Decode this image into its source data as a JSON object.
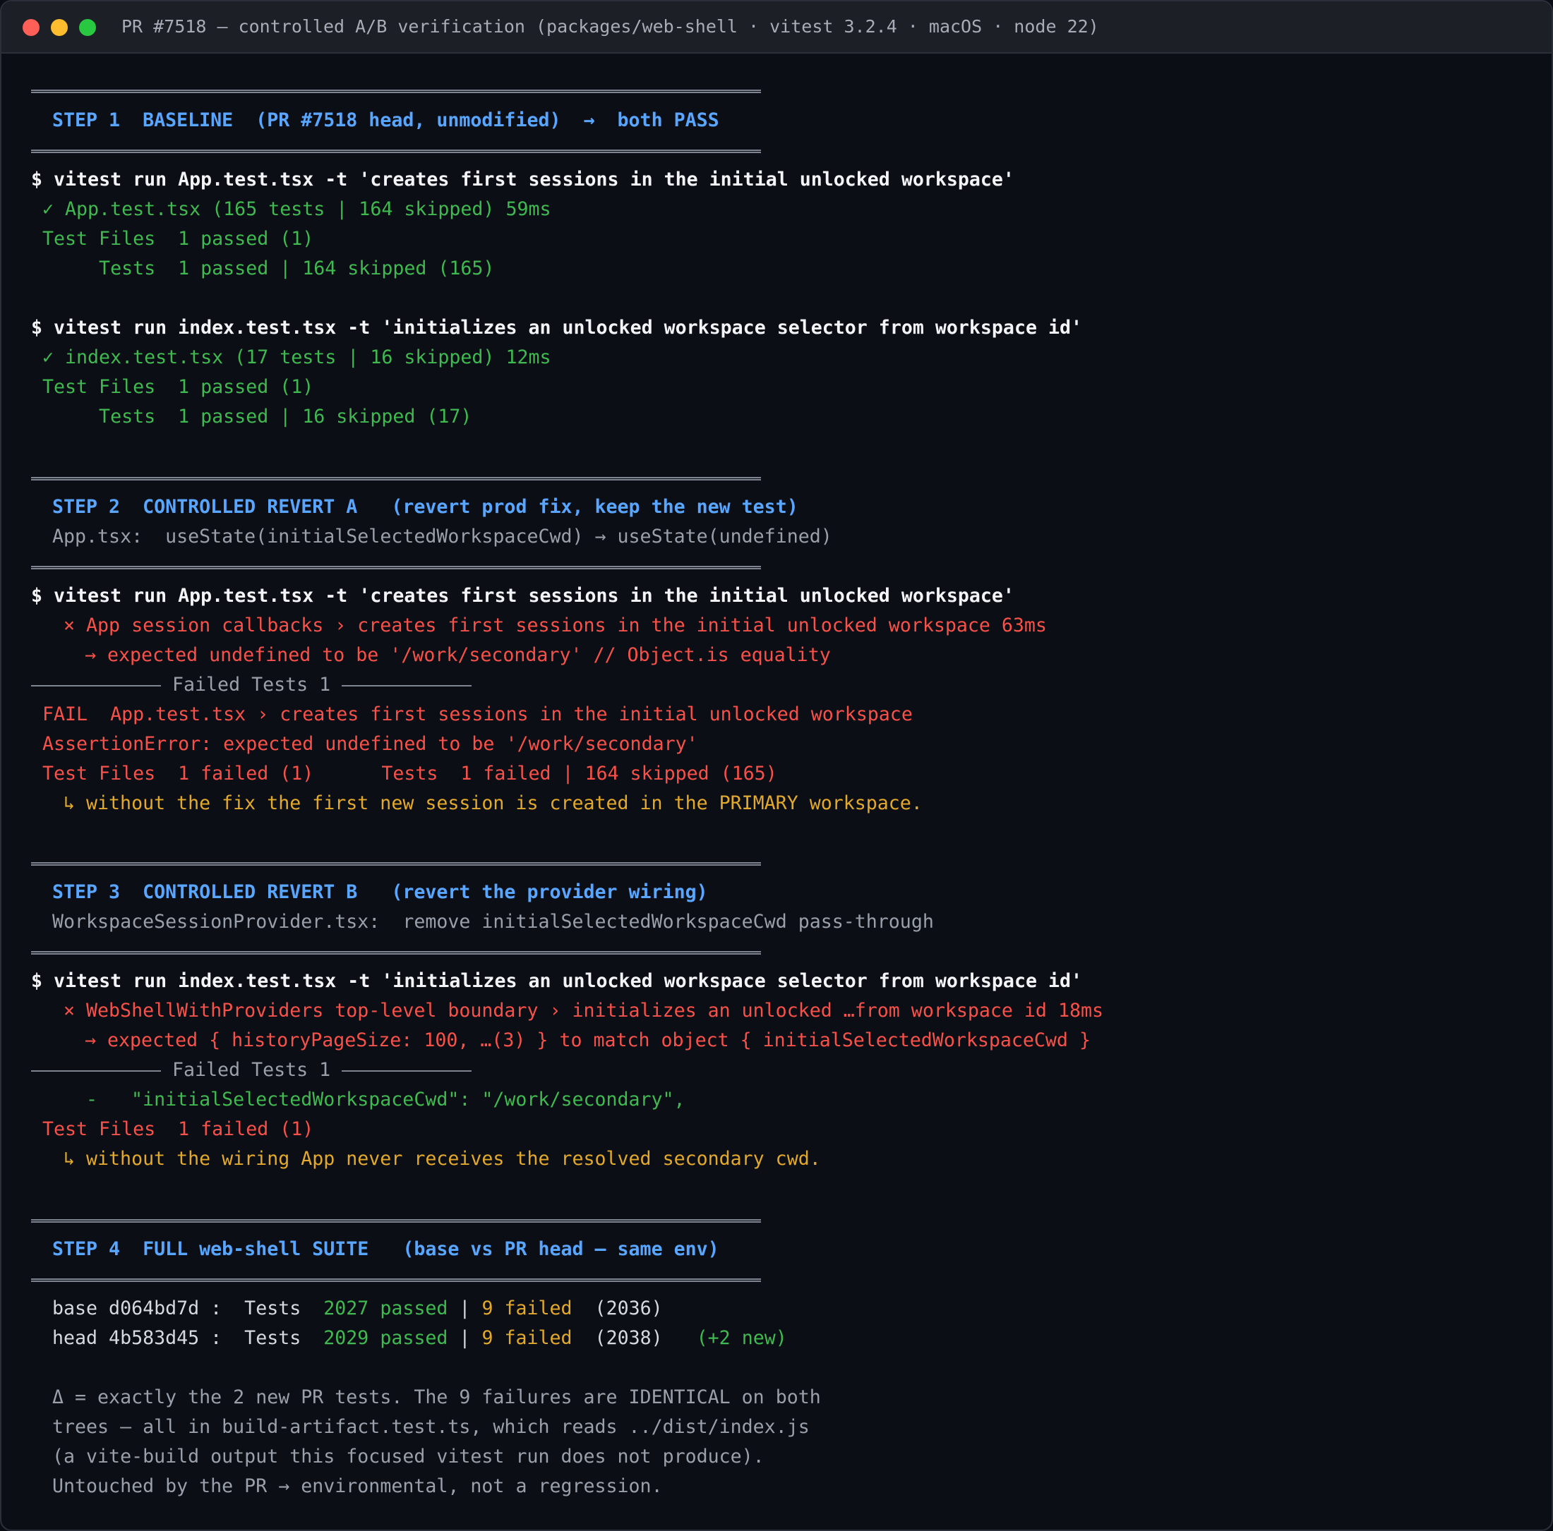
{
  "window": {
    "title": "PR #7518 — controlled A/B verification (packages/web-shell · vitest 3.2.4 · macOS · node 22)"
  },
  "step1": {
    "header": "STEP 1  BASELINE  (PR #7518 head, unmodified)  →  both PASS",
    "cmd1": "$ vitest run App.test.tsx -t 'creates first sessions in the initial unlocked workspace'",
    "res1": "✓ App.test.tsx (165 tests | 164 skipped) 59ms",
    "files1": "Test Files  1 passed (1)",
    "tests1": "     Tests  1 passed | 164 skipped (165)",
    "cmd2": "$ vitest run index.test.tsx -t 'initializes an unlocked workspace selector from workspace id'",
    "res2": "✓ index.test.tsx (17 tests | 16 skipped) 12ms",
    "files2": "Test Files  1 passed (1)",
    "tests2": "     Tests  1 passed | 16 skipped (17)"
  },
  "step2": {
    "header": "STEP 2  CONTROLLED REVERT A   (revert prod fix, keep the new test)",
    "sub": "App.tsx:  useState(initialSelectedWorkspaceCwd) → useState(undefined)",
    "cmd": "$ vitest run App.test.tsx -t 'creates first sessions in the initial unlocked workspace'",
    "fail_line": "× App session callbacks › creates first sessions in the initial unlocked workspace 63ms",
    "expect_line": "→ expected undefined to be '/work/secondary' // Object.is equality",
    "failed_tests": "Failed Tests 1",
    "fail_detail": "FAIL  App.test.tsx › creates first sessions in the initial unlocked workspace",
    "assertion": "AssertionError: expected undefined to be '/work/secondary'",
    "summary": "Test Files  1 failed (1)      Tests  1 failed | 164 skipped (165)",
    "note": "↳ without the fix the first new session is created in the PRIMARY workspace."
  },
  "step3": {
    "header": "STEP 3  CONTROLLED REVERT B   (revert the provider wiring)",
    "sub": "WorkspaceSessionProvider.tsx:  remove initialSelectedWorkspaceCwd pass-through",
    "cmd": "$ vitest run index.test.tsx -t 'initializes an unlocked workspace selector from workspace id'",
    "fail_line": "× WebShellWithProviders top-level boundary › initializes an unlocked …from workspace id 18ms",
    "expect_line": "→ expected { historyPageSize: 100, …(3) } to match object { initialSelectedWorkspaceCwd }",
    "failed_tests": "Failed Tests 1",
    "diff_line": "-   \"initialSelectedWorkspaceCwd\": \"/work/secondary\",",
    "summary": "Test Files  1 failed (1)",
    "note": "↳ without the wiring App never receives the resolved secondary cwd."
  },
  "step4": {
    "header": "STEP 4  FULL web-shell SUITE   (base vs PR head — same env)",
    "base": {
      "label": "base d064bd7d :  Tests  ",
      "passed": "2027 passed",
      "pipe": " | ",
      "failed": "9 failed",
      "total": "  (2036)"
    },
    "head": {
      "label": "head 4b583d45 :  Tests  ",
      "passed": "2029 passed",
      "pipe": " | ",
      "failed": "9 failed",
      "total": "  (2038)",
      "new": "   (+2 new)"
    },
    "notes": [
      "Δ = exactly the 2 new PR tests. The 9 failures are IDENTICAL on both",
      "trees — all in build-artifact.test.ts, which reads ../dist/index.js",
      "(a vite-build output this focused vitest run does not produce).",
      "Untouched by the PR → environmental, not a regression."
    ]
  },
  "colors": {
    "background": "#0b0e15",
    "header_blue": "#58a6ff",
    "pass_green": "#3fb950",
    "fail_red": "#f85149",
    "note_orange": "#e3a92a"
  }
}
